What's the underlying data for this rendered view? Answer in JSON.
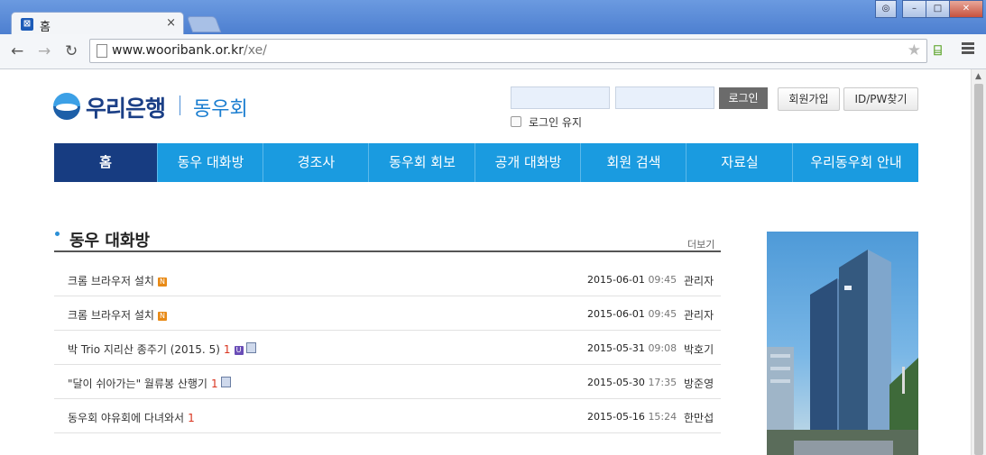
{
  "browser": {
    "tab_title": "홈",
    "tab_close": "×",
    "url_host": "www.wooribank.or.kr",
    "url_path": "/xe/",
    "back": "←",
    "forward": "→",
    "reload": "↻",
    "star": "★"
  },
  "header": {
    "logo_main": "우리은행",
    "logo_sub": "동우회",
    "login_button": "로그인",
    "join_button": "회원가입",
    "find_button": "ID/PW찾기",
    "keep_login": "로그인 유지"
  },
  "nav": {
    "items": [
      "홈",
      "동우 대화방",
      "경조사",
      "동우회 회보",
      "공개 대화방",
      "회원 검색",
      "자료실",
      "우리동우회 안내"
    ],
    "active_index": 0
  },
  "board": {
    "title": "동우 대화방",
    "more": "더보기",
    "posts": [
      {
        "title": "크롬 브라우저 설치",
        "count": "",
        "badges": [
          "new"
        ],
        "date": "2015-06-01",
        "time": "09:45",
        "author": "관리자"
      },
      {
        "title": "크롬 브라우저 설치",
        "count": "",
        "badges": [
          "new"
        ],
        "date": "2015-06-01",
        "time": "09:45",
        "author": "관리자"
      },
      {
        "title": "박 Trio 지리산 종주기 (2015. 5)",
        "count": "1",
        "badges": [
          "update",
          "file"
        ],
        "date": "2015-05-31",
        "time": "09:08",
        "author": "박호기"
      },
      {
        "title": "\"달이 쉬아가는\" 월류봉 산행기",
        "count": "1",
        "badges": [
          "file"
        ],
        "date": "2015-05-30",
        "time": "17:35",
        "author": "방준영"
      },
      {
        "title": "동우회 야유회에 다녀와서",
        "count": "1",
        "badges": [],
        "date": "2015-05-16",
        "time": "15:24",
        "author": "한만섭"
      }
    ]
  },
  "colors": {
    "nav_bg": "#1a9be0",
    "nav_active": "#173c81",
    "brand": "#1b3f86",
    "comment_count": "#d9341f"
  }
}
